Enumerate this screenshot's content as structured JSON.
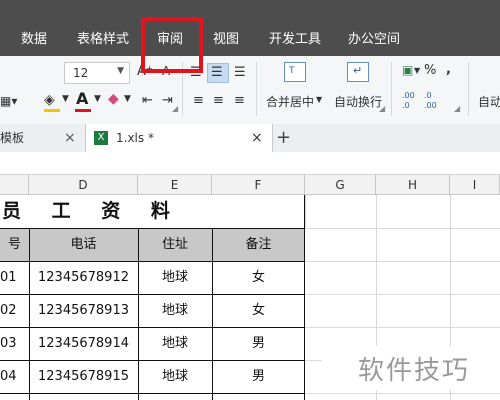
{
  "menu": {
    "items": [
      "数据",
      "表格样式",
      "审阅",
      "视图",
      "开发工具",
      "办公空间"
    ],
    "highlight_color": "#e0141e"
  },
  "toolbar": {
    "font_size": "12",
    "merge_center": "合并居中",
    "auto_wrap": "自动换行",
    "auto_right": "自动",
    "percent_icon": "%",
    "comma_icon": "‚",
    "increase_font": "A⁺",
    "decrease_font": "A⁻",
    "dec_add": ".00",
    "dec_remove": ".0"
  },
  "tabs": {
    "template": "模板",
    "file": "1.xls *",
    "close": "×",
    "add": "+"
  },
  "columns": [
    "D",
    "E",
    "F",
    "G",
    "H",
    "I"
  ],
  "sheet": {
    "title": "员 工 资 料",
    "header_partial": "号",
    "headers": [
      "电话",
      "住址",
      "备注"
    ],
    "rows": [
      {
        "id": "01",
        "phone": "12345678912",
        "addr": "地球",
        "note": "女"
      },
      {
        "id": "02",
        "phone": "12345678913",
        "addr": "地球",
        "note": "女"
      },
      {
        "id": "03",
        "phone": "12345678914",
        "addr": "地球",
        "note": "男"
      },
      {
        "id": "04",
        "phone": "12345678915",
        "addr": "地球",
        "note": "男"
      }
    ]
  },
  "watermark": "软件技巧"
}
